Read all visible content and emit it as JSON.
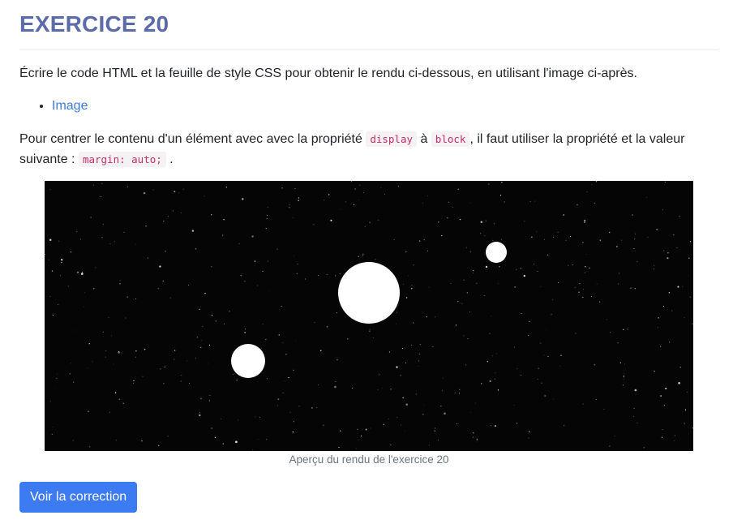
{
  "header": {
    "title": "EXERCICE 20"
  },
  "content": {
    "intro": "Écrire le code HTML et la feuille de style CSS pour obtenir le rendu ci-dessous, en utilisant l'image ci-après.",
    "links": [
      {
        "label": "Image"
      }
    ],
    "paragraph": {
      "part1": "Pour centrer le contenu d'un élément avec avec la propriété ",
      "code1": "display",
      "part2": " à ",
      "code2": "block",
      "part3": ", il faut utiliser la propriété et la valeur suivante : ",
      "code3": "margin: auto;",
      "part4": " ."
    },
    "preview": {
      "background_color": "#050505",
      "circle_color": "#ffffff",
      "caption": "Aperçu du rendu de l'exercice 20"
    },
    "button": {
      "label": "Voir la correction",
      "color": "#3d7bf2"
    }
  },
  "colors": {
    "title": "#5b6aa8",
    "link": "#3d7be0",
    "code_text": "#c0306a"
  }
}
